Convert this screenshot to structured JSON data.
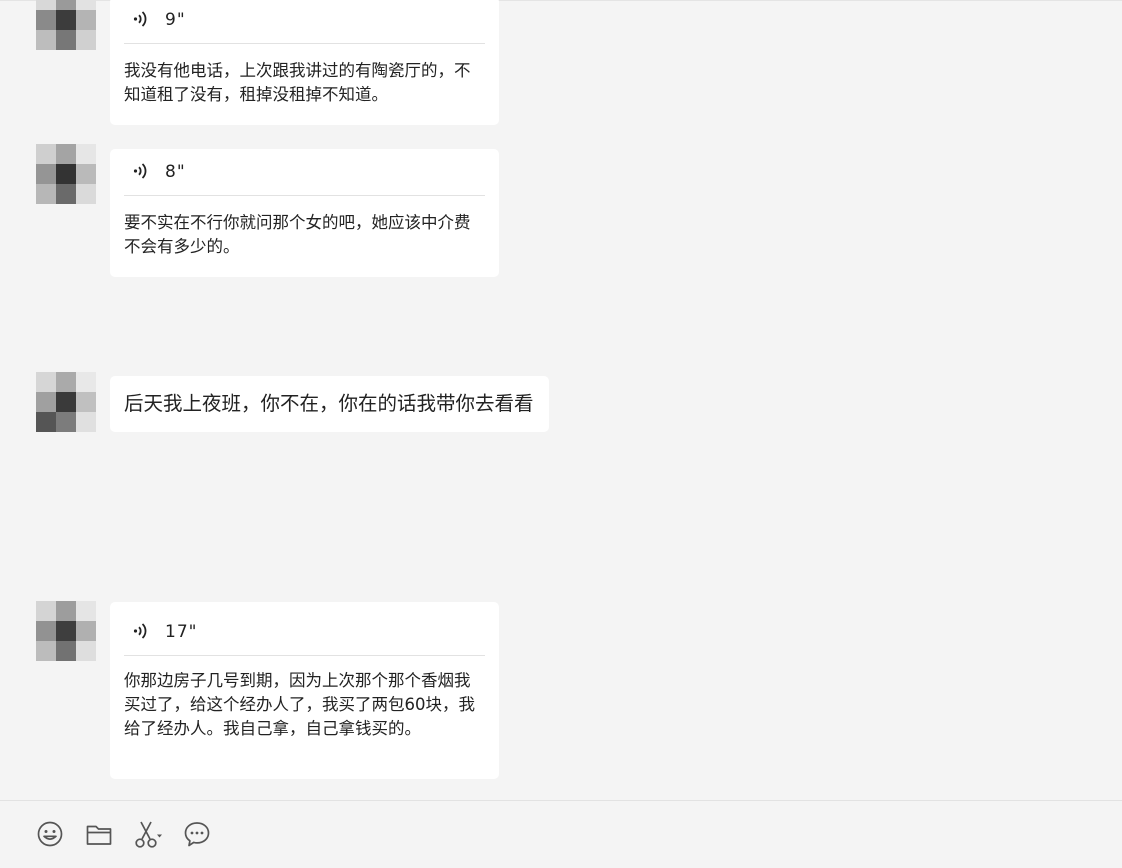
{
  "messages": [
    {
      "type": "voice",
      "duration": "9\"",
      "transcript": "我没有他电话，上次跟我讲过的有陶瓷厅的，不知道租了没有，租掉没租掉不知道。"
    },
    {
      "type": "voice",
      "duration": "8\"",
      "transcript": "要不实在不行你就问那个女的吧，她应该中介费不会有多少的。"
    },
    {
      "type": "text",
      "text": "后天我上夜班，你不在，你在的话我带你去看看"
    },
    {
      "type": "voice",
      "duration": "17\"",
      "transcript": "你那边房子几号到期，因为上次那个那个香烟我买过了，给这个经办人了，我买了两包60块，我给了经办人。我自己拿，自己拿钱买的。"
    }
  ],
  "toolbar": {
    "icons": [
      "emoji-icon",
      "folder-icon",
      "scissors-icon",
      "chat-history-icon"
    ]
  },
  "colors": {
    "background": "#f4f4f4",
    "bubble": "#ffffff",
    "text": "#222222",
    "divider": "#e2e2e2"
  }
}
